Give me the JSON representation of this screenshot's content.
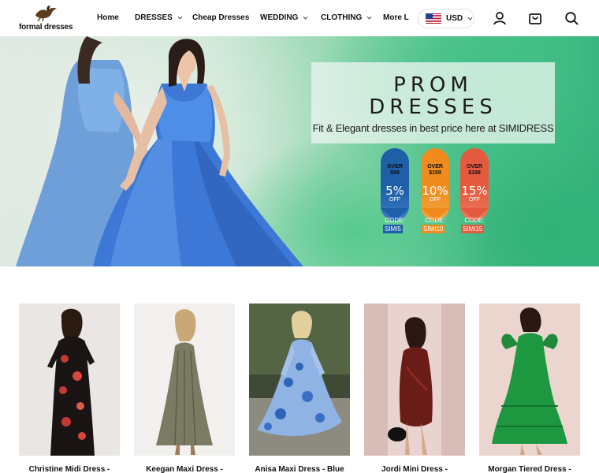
{
  "brand": {
    "logo_text": "formal dresses"
  },
  "nav": {
    "items": [
      {
        "label": "Home",
        "has_dropdown": false
      },
      {
        "label": "DRESSES",
        "has_dropdown": true
      },
      {
        "label": "Cheap Dresses",
        "has_dropdown": false
      },
      {
        "label": "WEDDING",
        "has_dropdown": true
      },
      {
        "label": "CLOTHING",
        "has_dropdown": true
      },
      {
        "label": "More Li",
        "has_dropdown": false
      }
    ],
    "currency": "USD"
  },
  "hero": {
    "title_line1": "PROM",
    "title_line2": "DRESSES",
    "subtitle": "Fit & Elegant dresses in best price here at SIMIDRESS",
    "offers": [
      {
        "over": "OVER",
        "price": "$99",
        "percent": "5%",
        "off": "OFF",
        "code_label": "CODE:",
        "code": "SIMI5",
        "color": "#1e5fa8"
      },
      {
        "over": "OVER",
        "price": "$159",
        "percent": "10%",
        "off": "OFF",
        "code_label": "CODE:",
        "code": "SIMI10",
        "color": "#f08c1e"
      },
      {
        "over": "OVER",
        "price": "$199",
        "percent": "15%",
        "off": "OFF",
        "code_label": "CODE:",
        "code": "SIMI15",
        "color": "#e45a3f"
      }
    ]
  },
  "products": [
    {
      "name": "Christine Midi Dress -"
    },
    {
      "name": "Keegan Maxi Dress -"
    },
    {
      "name": "Anisa Maxi Dress - Blue"
    },
    {
      "name": "Jordi Mini Dress -"
    },
    {
      "name": "Morgan Tiered Dress -"
    }
  ],
  "colors": {
    "accent": "#111111",
    "hero_green": "#38b47e"
  }
}
